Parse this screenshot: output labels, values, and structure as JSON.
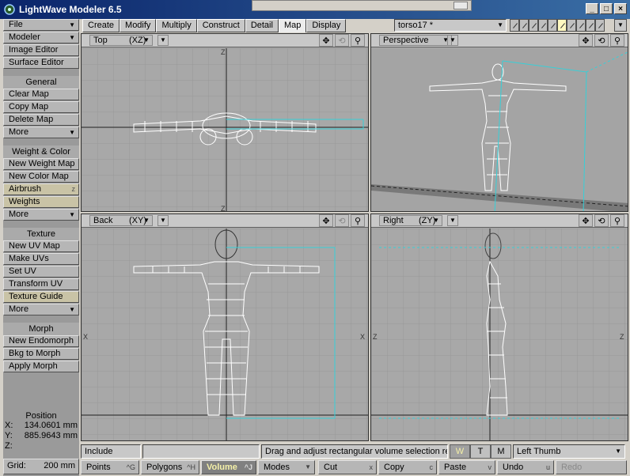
{
  "window": {
    "title": "LightWave Modeler 6.5"
  },
  "sidebar": {
    "file": "File",
    "modeler": "Modeler",
    "image_editor": "Image Editor",
    "surface_editor": "Surface Editor",
    "general": {
      "header": "General",
      "clear_map": "Clear Map",
      "copy_map": "Copy Map",
      "delete_map": "Delete Map",
      "more": "More"
    },
    "weight_color": {
      "header": "Weight & Color",
      "new_weight_map": "New Weight Map",
      "new_color_map": "New Color Map",
      "airbrush": "Airbrush",
      "airbrush_shortcut": "z",
      "weights": "Weights",
      "more": "More"
    },
    "texture": {
      "header": "Texture",
      "new_uv_map": "New UV Map",
      "make_uvs": "Make UVs",
      "set_uv": "Set UV",
      "transform_uv": "Transform UV",
      "texture_guide": "Texture Guide",
      "more": "More"
    },
    "morph": {
      "header": "Morph",
      "new_endomorph": "New Endomorph",
      "bkg_to_morph": "Bkg to Morph",
      "apply_morph": "Apply Morph"
    }
  },
  "position": {
    "title": "Position",
    "x_label": "X:",
    "x": "134.0601 mm",
    "y_label": "Y:",
    "y": "885.9643 mm",
    "z_label": "Z:",
    "z": ""
  },
  "grid": {
    "label": "Grid:",
    "value": "200 mm"
  },
  "tabs": [
    "Create",
    "Modify",
    "Multiply",
    "Construct",
    "Detail",
    "Map",
    "Display"
  ],
  "active_tab": "Map",
  "object_selector": "torso17 *",
  "viewports": {
    "top": {
      "name": "Top",
      "axis": "(XZ)"
    },
    "perspective": {
      "name": "Perspective",
      "axis": ""
    },
    "back": {
      "name": "Back",
      "axis": "(XY)"
    },
    "right": {
      "name": "Right",
      "axis": "(ZY)"
    }
  },
  "status": {
    "include": "Include",
    "message": "Drag and adjust rectangular volume selection re...",
    "w": "W",
    "t": "T",
    "m": "M",
    "left_thumb": "Left Thumb"
  },
  "bottom": {
    "points": "Points",
    "points_sc": "^G",
    "polygons": "Polygons",
    "polygons_sc": "^H",
    "volume": "Volume",
    "volume_sc": "^J",
    "modes": "Modes",
    "cut": "Cut",
    "cut_sc": "x",
    "copy": "Copy",
    "copy_sc": "c",
    "paste": "Paste",
    "paste_sc": "v",
    "undo": "Undo",
    "undo_sc": "u",
    "redo": "Redo"
  },
  "colors": {
    "selection": "#36d0d8",
    "mesh": "#ffffff",
    "viewport_bg": "#a8a8a8"
  }
}
